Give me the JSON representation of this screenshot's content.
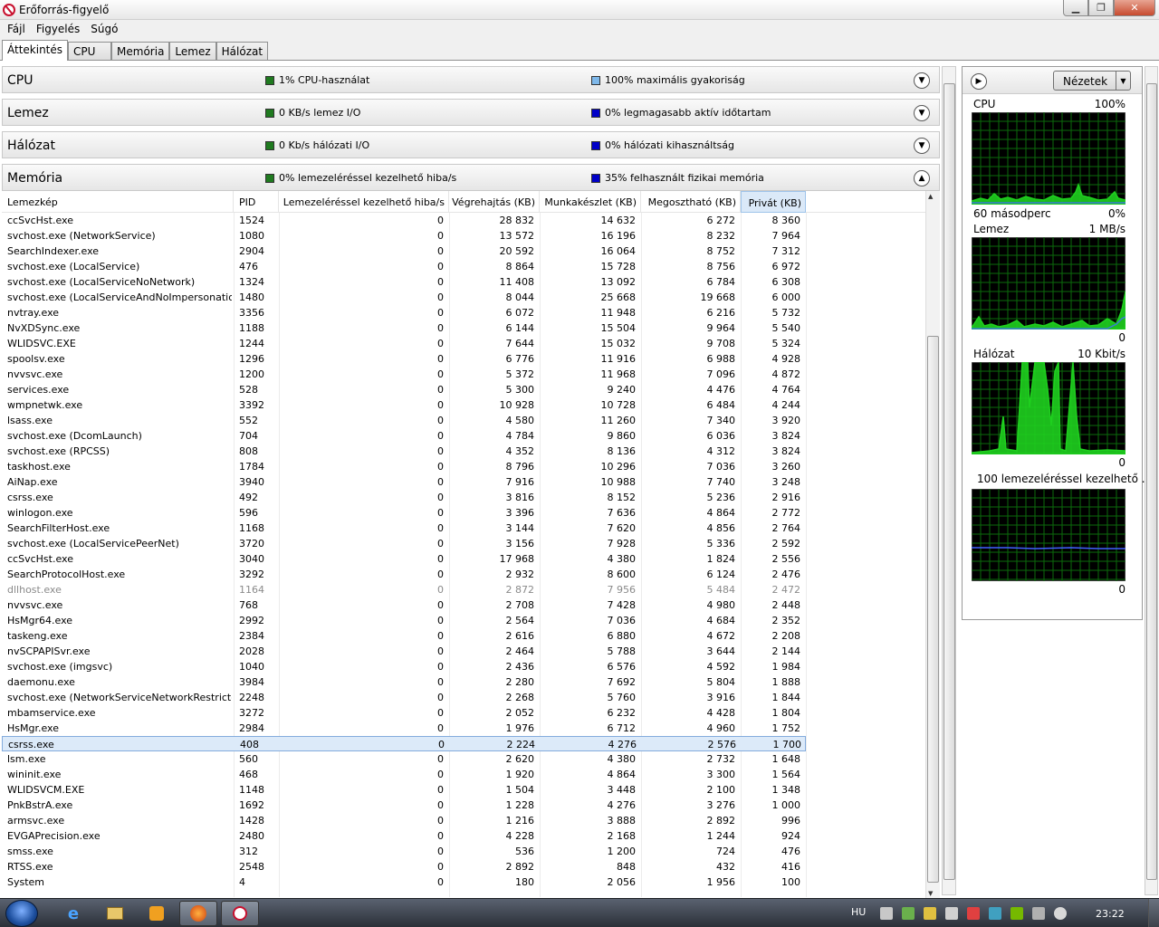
{
  "window": {
    "title": "Erőforrás-figyelő",
    "min_icon": "minimize-icon",
    "max_icon": "maximize-icon",
    "close_icon": "close-icon"
  },
  "menu": [
    "Fájl",
    "Figyelés",
    "Súgó"
  ],
  "tabs": [
    "Áttekintés",
    "CPU",
    "Memória",
    "Lemez",
    "Hálózat"
  ],
  "sections": [
    {
      "title": "CPU",
      "stat1": "1% CPU-használat",
      "stat1_color": "#1f7a1f",
      "stat2": "100% maximális gyakoriság",
      "stat2_color": "#7eb8ea",
      "expanded": false
    },
    {
      "title": "Lemez",
      "stat1": "0 KB/s lemez I/O",
      "stat1_color": "#1f7a1f",
      "stat2": "0% legmagasabb aktív időtartam",
      "stat2_color": "#0000c8",
      "expanded": false
    },
    {
      "title": "Hálózat",
      "stat1": "0 Kb/s hálózati I/O",
      "stat1_color": "#1f7a1f",
      "stat2": "0% hálózati kihasználtság",
      "stat2_color": "#0000c8",
      "expanded": false
    },
    {
      "title": "Memória",
      "stat1": "0% lemezeléréssel kezelhető hiba/s",
      "stat1_color": "#1f7a1f",
      "stat2": "35% felhasznált fizikai memória",
      "stat2_color": "#0000c8",
      "expanded": true
    }
  ],
  "columns": [
    "Lemezkép",
    "PID",
    "Lemezeléréssel kezelhető hiba/s",
    "Végrehajtás (KB)",
    "Munkakészlet (KB)",
    "Megosztható (KB)",
    "Privát (KB)"
  ],
  "rows": [
    [
      "ccSvcHst.exe",
      "1524",
      "0",
      "28 832",
      "14 632",
      "6 272",
      "8 360"
    ],
    [
      "svchost.exe (NetworkService)",
      "1080",
      "0",
      "13 572",
      "16 196",
      "8 232",
      "7 964"
    ],
    [
      "SearchIndexer.exe",
      "2904",
      "0",
      "20 592",
      "16 064",
      "8 752",
      "7 312"
    ],
    [
      "svchost.exe (LocalService)",
      "476",
      "0",
      "8 864",
      "15 728",
      "8 756",
      "6 972"
    ],
    [
      "svchost.exe (LocalServiceNoNetwork)",
      "1324",
      "0",
      "11 408",
      "13 092",
      "6 784",
      "6 308"
    ],
    [
      "svchost.exe (LocalServiceAndNoImpersonation)",
      "1480",
      "0",
      "8 044",
      "25 668",
      "19 668",
      "6 000"
    ],
    [
      "nvtray.exe",
      "3356",
      "0",
      "6 072",
      "11 948",
      "6 216",
      "5 732"
    ],
    [
      "NvXDSync.exe",
      "1188",
      "0",
      "6 144",
      "15 504",
      "9 964",
      "5 540"
    ],
    [
      "WLIDSVC.EXE",
      "1244",
      "0",
      "7 644",
      "15 032",
      "9 708",
      "5 324"
    ],
    [
      "spoolsv.exe",
      "1296",
      "0",
      "6 776",
      "11 916",
      "6 988",
      "4 928"
    ],
    [
      "nvvsvc.exe",
      "1200",
      "0",
      "5 372",
      "11 968",
      "7 096",
      "4 872"
    ],
    [
      "services.exe",
      "528",
      "0",
      "5 300",
      "9 240",
      "4 476",
      "4 764"
    ],
    [
      "wmpnetwk.exe",
      "3392",
      "0",
      "10 928",
      "10 728",
      "6 484",
      "4 244"
    ],
    [
      "lsass.exe",
      "552",
      "0",
      "4 580",
      "11 260",
      "7 340",
      "3 920"
    ],
    [
      "svchost.exe (DcomLaunch)",
      "704",
      "0",
      "4 784",
      "9 860",
      "6 036",
      "3 824"
    ],
    [
      "svchost.exe (RPCSS)",
      "808",
      "0",
      "4 352",
      "8 136",
      "4 312",
      "3 824"
    ],
    [
      "taskhost.exe",
      "1784",
      "0",
      "8 796",
      "10 296",
      "7 036",
      "3 260"
    ],
    [
      "AiNap.exe",
      "3940",
      "0",
      "7 916",
      "10 988",
      "7 740",
      "3 248"
    ],
    [
      "csrss.exe",
      "492",
      "0",
      "3 816",
      "8 152",
      "5 236",
      "2 916"
    ],
    [
      "winlogon.exe",
      "596",
      "0",
      "3 396",
      "7 636",
      "4 864",
      "2 772"
    ],
    [
      "SearchFilterHost.exe",
      "1168",
      "0",
      "3 144",
      "7 620",
      "4 856",
      "2 764"
    ],
    [
      "svchost.exe (LocalServicePeerNet)",
      "3720",
      "0",
      "3 156",
      "7 928",
      "5 336",
      "2 592"
    ],
    [
      "ccSvcHst.exe",
      "3040",
      "0",
      "17 968",
      "4 380",
      "1 824",
      "2 556"
    ],
    [
      "SearchProtocolHost.exe",
      "3292",
      "0",
      "2 932",
      "8 600",
      "6 124",
      "2 476"
    ],
    [
      "dllhost.exe",
      "1164",
      "0",
      "2 872",
      "7 956",
      "5 484",
      "2 472"
    ],
    [
      "nvvsvc.exe",
      "768",
      "0",
      "2 708",
      "7 428",
      "4 980",
      "2 448"
    ],
    [
      "HsMgr64.exe",
      "2992",
      "0",
      "2 564",
      "7 036",
      "4 684",
      "2 352"
    ],
    [
      "taskeng.exe",
      "2384",
      "0",
      "2 616",
      "6 880",
      "4 672",
      "2 208"
    ],
    [
      "nvSCPAPISvr.exe",
      "2028",
      "0",
      "2 464",
      "5 788",
      "3 644",
      "2 144"
    ],
    [
      "svchost.exe (imgsvc)",
      "1040",
      "0",
      "2 436",
      "6 576",
      "4 592",
      "1 984"
    ],
    [
      "daemonu.exe",
      "3984",
      "0",
      "2 280",
      "7 692",
      "5 804",
      "1 888"
    ],
    [
      "svchost.exe (NetworkServiceNetworkRestricted)",
      "2248",
      "0",
      "2 268",
      "5 760",
      "3 916",
      "1 844"
    ],
    [
      "mbamservice.exe",
      "3272",
      "0",
      "2 052",
      "6 232",
      "4 428",
      "1 804"
    ],
    [
      "HsMgr.exe",
      "2984",
      "0",
      "1 976",
      "6 712",
      "4 960",
      "1 752"
    ],
    [
      "csrss.exe",
      "408",
      "0",
      "2 224",
      "4 276",
      "2 576",
      "1 700"
    ],
    [
      "lsm.exe",
      "560",
      "0",
      "2 620",
      "4 380",
      "2 732",
      "1 648"
    ],
    [
      "wininit.exe",
      "468",
      "0",
      "1 920",
      "4 864",
      "3 300",
      "1 564"
    ],
    [
      "WLIDSVCM.EXE",
      "1148",
      "0",
      "1 504",
      "3 448",
      "2 100",
      "1 348"
    ],
    [
      "PnkBstrA.exe",
      "1692",
      "0",
      "1 228",
      "4 276",
      "3 276",
      "1 000"
    ],
    [
      "armsvc.exe",
      "1428",
      "0",
      "1 216",
      "3 888",
      "2 892",
      "996"
    ],
    [
      "EVGAPrecision.exe",
      "2480",
      "0",
      "4 228",
      "2 168",
      "1 244",
      "924"
    ],
    [
      "smss.exe",
      "312",
      "0",
      "536",
      "1 200",
      "724",
      "476"
    ],
    [
      "RTSS.exe",
      "2548",
      "0",
      "2 892",
      "848",
      "432",
      "416"
    ],
    [
      "System",
      "4",
      "0",
      "180",
      "2 056",
      "1 956",
      "100"
    ]
  ],
  "selected_row": 34,
  "dim_row": 24,
  "right_pane": {
    "views_label": "Nézetek",
    "graphs": [
      {
        "label": "CPU",
        "value_top": "100%",
        "footer_left": "60 másodperc",
        "footer_right": "0%"
      },
      {
        "label": "Lemez",
        "value_top": "1 MB/s",
        "footer_left": "",
        "footer_right": "0"
      },
      {
        "label": "Hálózat",
        "value_top": "10 Kbit/s",
        "footer_left": "",
        "footer_right": "0"
      },
      {
        "label": "100 lemezeléréssel kezelhető ...",
        "value_top": "",
        "footer_left": "",
        "footer_right": "0"
      }
    ]
  },
  "taskbar": {
    "lang": "HU",
    "clock": "23:22"
  }
}
